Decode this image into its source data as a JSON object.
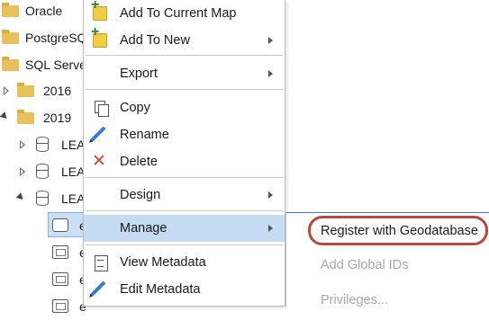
{
  "tree": {
    "items": [
      {
        "label": "Oracle"
      },
      {
        "label": "PostgreSQ"
      },
      {
        "label": "SQL Serve"
      },
      {
        "label": "2016"
      },
      {
        "label": "2019"
      },
      {
        "label": "LEA"
      },
      {
        "label": "LEA"
      },
      {
        "label": "LEA"
      },
      {
        "label": "e"
      },
      {
        "label": "e"
      },
      {
        "label": "e"
      },
      {
        "label": "e"
      }
    ]
  },
  "context_menu": {
    "add_to_current_map": "Add To Current Map",
    "add_to_new": "Add To New",
    "export": "Export",
    "copy": "Copy",
    "rename": "Rename",
    "delete": "Delete",
    "design": "Design",
    "manage": "Manage",
    "view_metadata": "View Metadata",
    "edit_metadata": "Edit Metadata"
  },
  "submenu": {
    "register_with_geodatabase": "Register with Geodatabase",
    "add_global_ids": "Add Global IDs",
    "privileges": "Privileges..."
  },
  "colors": {
    "highlight": "#c5dcf2",
    "annotation_ring": "#b8493b",
    "folder": "#e8c15a",
    "disabled_text": "#a8a8a8"
  }
}
